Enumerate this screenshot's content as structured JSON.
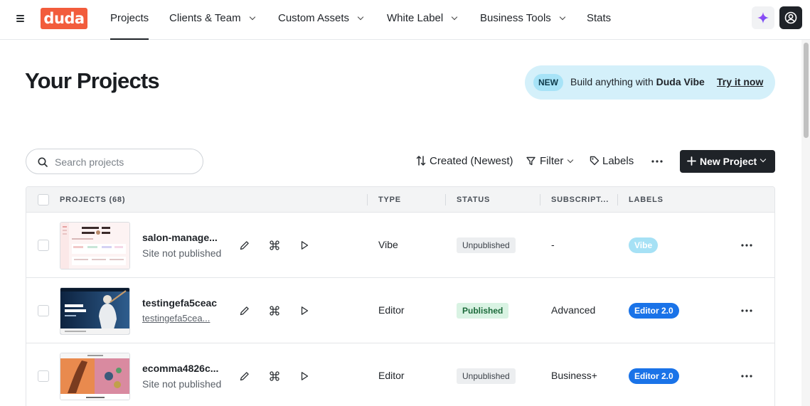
{
  "nav": {
    "logo": "duda",
    "items": [
      {
        "label": "Projects",
        "active": true,
        "dropdown": false
      },
      {
        "label": "Clients & Team",
        "dropdown": true
      },
      {
        "label": "Custom Assets",
        "dropdown": true
      },
      {
        "label": "White Label",
        "dropdown": true
      },
      {
        "label": "Business Tools",
        "dropdown": true
      },
      {
        "label": "Stats",
        "dropdown": false
      }
    ],
    "icons": [
      "menu-icon",
      "sparkle-icon",
      "account-icon"
    ]
  },
  "header": {
    "title": "Your Projects",
    "banner": {
      "badge": "NEW",
      "text_prefix": "Build anything with ",
      "text_bold": "Duda Vibe",
      "link": "Try it now"
    }
  },
  "toolbar": {
    "search_placeholder": "Search projects",
    "sort_label": "Created (Newest)",
    "filter_label": "Filter",
    "labels_label": "Labels",
    "new_project_label": "New Project"
  },
  "table": {
    "columns": [
      "PROJECTS (68)",
      "TYPE",
      "STATUS",
      "SUBSCRIPT...",
      "LABELS"
    ],
    "rows": [
      {
        "name": "salon-manage...",
        "subtitle": "Site not published",
        "subtitle_link": false,
        "type": "Vibe",
        "status": "Unpublished",
        "subscription": "-",
        "label": "Vibe",
        "label_color": "#a6e1f5"
      },
      {
        "name": "testingefa5ceac",
        "subtitle": "testingefa5cea...",
        "subtitle_link": true,
        "type": "Editor",
        "status": "Published",
        "subscription": "Advanced",
        "label": "Editor 2.0",
        "label_color": "#1a73e8"
      },
      {
        "name": "ecomma4826c...",
        "subtitle": "Site not published",
        "subtitle_link": false,
        "type": "Editor",
        "status": "Unpublished",
        "subscription": "Business+",
        "label": "Editor 2.0",
        "label_color": "#1a73e8"
      }
    ]
  },
  "colors": {
    "brand": "#f25c3c",
    "primary_dark": "#1f2328",
    "banner_bg": "#d4f0fa",
    "published_bg": "#d9f3e3",
    "label_blue": "#1a73e8",
    "label_vibe": "#a6e1f5"
  }
}
